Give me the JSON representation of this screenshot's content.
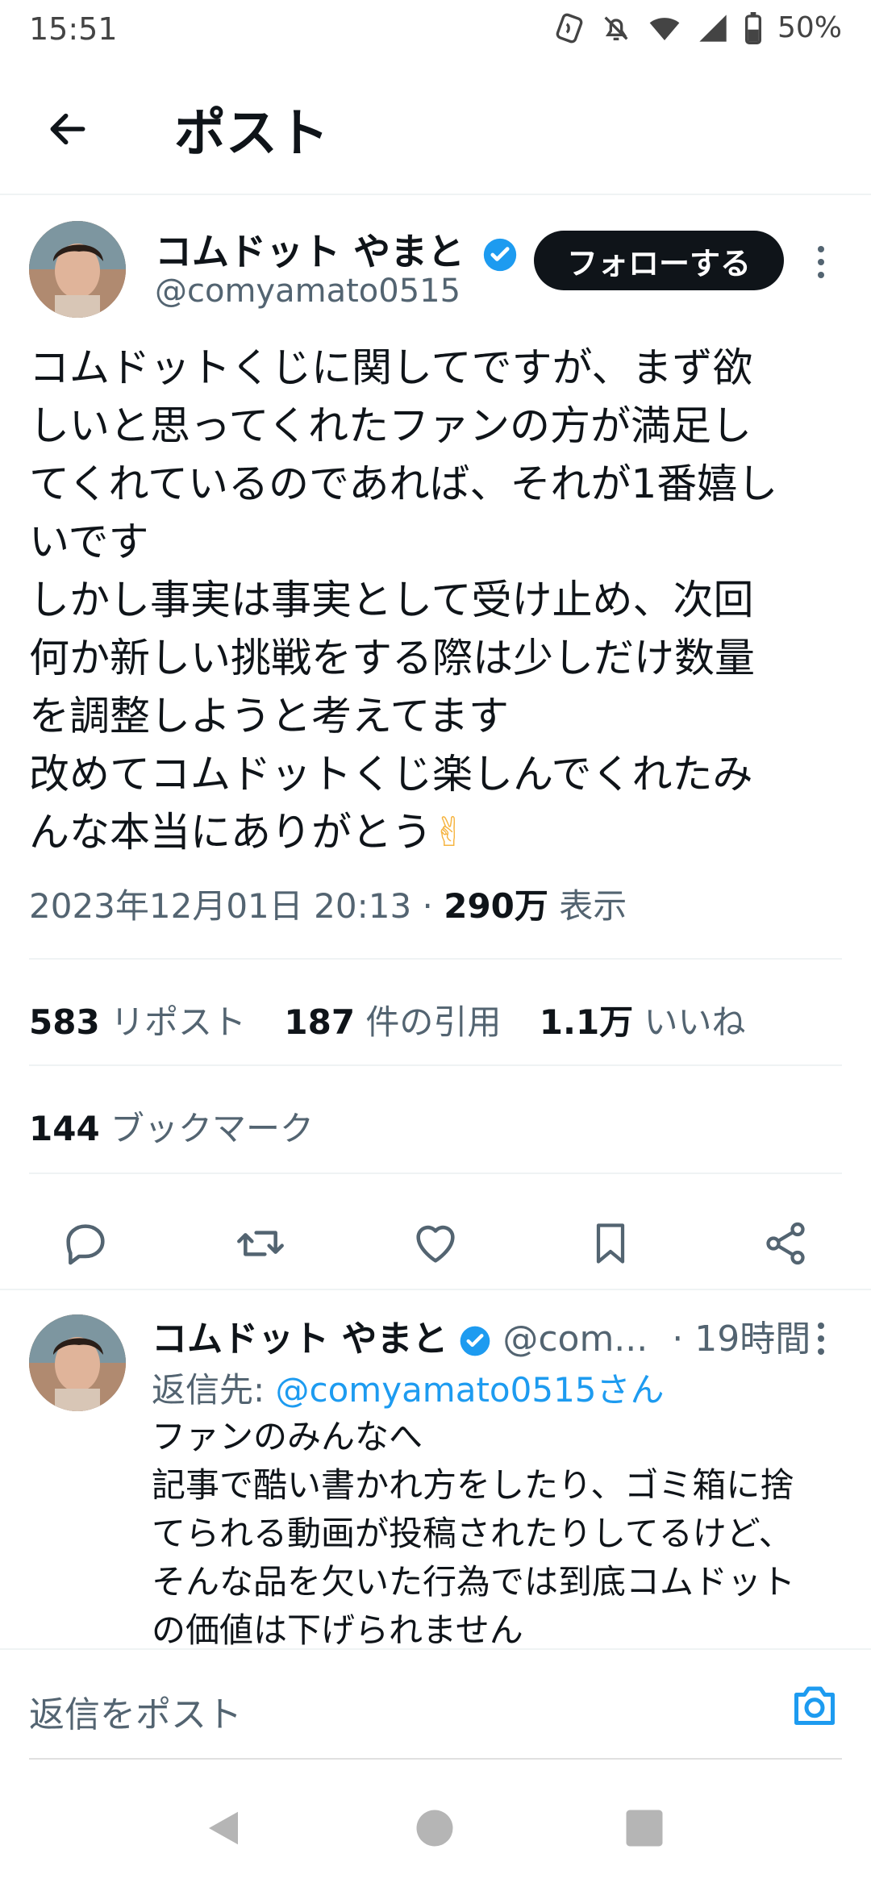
{
  "status": {
    "time": "15:51",
    "battery": "50%",
    "icons": [
      "nfc-icon",
      "mute-bell-icon",
      "wifi-icon",
      "signal-icon",
      "battery-icon"
    ]
  },
  "header": {
    "title": "ポスト"
  },
  "post": {
    "author_name": "コムドット やまと",
    "handle": "@comyamato0515",
    "follow_label": "フォローする",
    "lines": [
      "コムドットくじに関してですが、まず欲",
      "しいと思ってくれたファンの方が満足し",
      "てくれているのであれば、それが1番嬉し",
      "いです",
      "しかし事実は事実として受け止め、次回",
      "何か新しい挑戦をする際は少しだけ数量",
      "を調整しようと考えてます",
      "改めてコムドットくじ楽しんでくれたみ",
      "んな本当にありがとう"
    ],
    "emoji": "✌",
    "timestamp": "2023年12月01日 20:13 · ",
    "views_count": "290万",
    "views_label": " 表示"
  },
  "stats": {
    "reposts_count": "583",
    "reposts_label": " リポスト",
    "quotes_count": "187",
    "quotes_label": " 件の引用",
    "likes_count": "1.1万",
    "likes_label": " いいね",
    "bookmarks_count": "144",
    "bookmarks_label": " ブックマーク"
  },
  "reply": {
    "author_name": "コムドット やまと",
    "handle": "@com...",
    "time": "· 19時間",
    "reply_to_label": "返信先: ",
    "reply_to_handle": "@comyamato0515さん",
    "lines": [
      "ファンのみんなへ",
      "記事で酷い書かれ方をしたり、ゴミ箱に捨",
      "てられる動画が投稿されたりしてるけど、",
      "そんな品を欠いた行為では到底コムドット",
      "の価値は下げられません"
    ]
  },
  "composer": {
    "placeholder": "返信をポスト"
  },
  "colors": {
    "accent": "#1d9bf0",
    "text": "#0f1419",
    "muted": "#536471"
  }
}
